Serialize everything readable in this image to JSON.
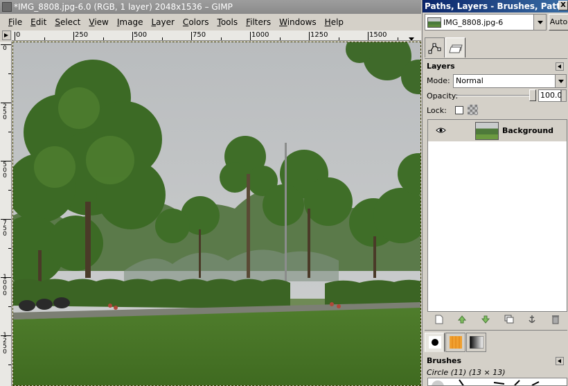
{
  "image_window": {
    "title": "*IMG_8808.jpg-6.0 (RGB, 1 layer) 2048x1536 – GIMP",
    "menu": [
      "File",
      "Edit",
      "Select",
      "View",
      "Image",
      "Layer",
      "Colors",
      "Tools",
      "Filters",
      "Windows",
      "Help"
    ],
    "hruler_labels": [
      "0",
      "250",
      "500",
      "750",
      "1000",
      "1250",
      "1500"
    ],
    "vruler_labels": [
      "0",
      "250",
      "500",
      "750",
      "1000",
      "1250"
    ]
  },
  "dock": {
    "title": "Paths, Layers - Brushes, Patterns...",
    "close_glyph": "X",
    "image_menu_label": "IMG_8808.jpg-6",
    "auto_label": "Auto",
    "layers": {
      "header": "Layers",
      "mode_label": "Mode:",
      "mode_value": "Normal",
      "opacity_label": "Opacity:",
      "opacity_value": "100.0",
      "lock_label": "Lock:",
      "items": [
        {
          "name": "Background",
          "visible": true
        }
      ]
    },
    "brushes": {
      "header": "Brushes",
      "current": "Circle (11) (13 × 13)"
    }
  },
  "icons": {
    "paths_tab": "paths-icon",
    "layers_tab": "layers-icon",
    "eye": "eye-icon",
    "new_layer": "new-layer-icon",
    "raise": "raise-icon",
    "lower": "lower-icon",
    "duplicate": "duplicate-icon",
    "anchor": "anchor-icon",
    "delete": "trash-icon",
    "brushes_tab": "brush-icon",
    "patterns_tab": "pattern-icon",
    "gradients_tab": "gradient-icon"
  }
}
